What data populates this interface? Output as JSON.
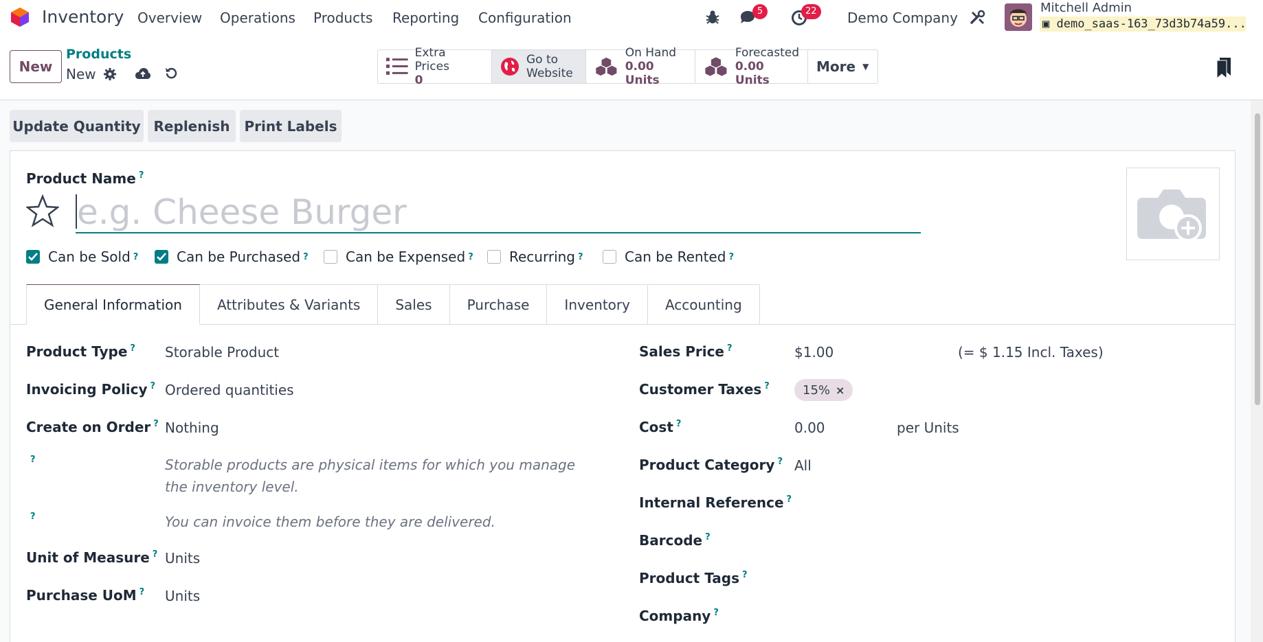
{
  "navbar": {
    "app_name": "Inventory",
    "menus": [
      "Overview",
      "Operations",
      "Products",
      "Reporting",
      "Configuration"
    ],
    "messages_count": "5",
    "activities_count": "22",
    "company": "Demo Company",
    "user_name": "Mitchell Admin",
    "database": "demo_saas-163_73d3b74a59..."
  },
  "control_panel": {
    "new_label": "New",
    "breadcrumb_parent": "Products",
    "breadcrumb_current": "New"
  },
  "smart_buttons": {
    "extra_prices_label": "Extra Prices",
    "extra_prices_value": "0",
    "website_label_1": "Go to",
    "website_label_2": "Website",
    "on_hand_label": "On Hand",
    "on_hand_value": "0.00 Units",
    "forecasted_label": "Forecasted",
    "forecasted_value": "0.00 Units",
    "more_label": "More"
  },
  "header_buttons": [
    "Update Quantity",
    "Replenish",
    "Print Labels"
  ],
  "form": {
    "product_name_label": "Product Name",
    "product_name_placeholder": "e.g. Cheese Burger",
    "checkboxes": [
      {
        "label": "Can be Sold",
        "checked": true
      },
      {
        "label": "Can be Purchased",
        "checked": true
      },
      {
        "label": "Can be Expensed",
        "checked": false
      },
      {
        "label": "Recurring",
        "checked": false
      },
      {
        "label": "Can be Rented",
        "checked": false
      }
    ],
    "tabs": [
      "General Information",
      "Attributes & Variants",
      "Sales",
      "Purchase",
      "Inventory",
      "Accounting"
    ],
    "left": {
      "product_type_label": "Product Type",
      "product_type_value": "Storable Product",
      "invoicing_policy_label": "Invoicing Policy",
      "invoicing_policy_value": "Ordered quantities",
      "create_on_order_label": "Create on Order",
      "create_on_order_value": "Nothing",
      "help_storable": "Storable products are physical items for which you manage the inventory level.",
      "help_invoice": "You can invoice them before they are delivered.",
      "uom_label": "Unit of Measure",
      "uom_value": "Units",
      "purchase_uom_label": "Purchase UoM",
      "purchase_uom_value": "Units"
    },
    "right": {
      "sales_price_label": "Sales Price",
      "sales_price_value": "$1.00",
      "incl_taxes": "(= $ 1.15 Incl. Taxes)",
      "customer_taxes_label": "Customer Taxes",
      "customer_tax_tag": "15%",
      "cost_label": "Cost",
      "cost_value": "0.00",
      "cost_unit": "per Units",
      "category_label": "Product Category",
      "category_value": "All",
      "internal_ref_label": "Internal Reference",
      "barcode_label": "Barcode",
      "tags_label": "Product Tags",
      "company_label": "Company"
    }
  },
  "colors": {
    "brand": "#714b67",
    "teal": "#017e84",
    "badge": "#e11d48"
  }
}
